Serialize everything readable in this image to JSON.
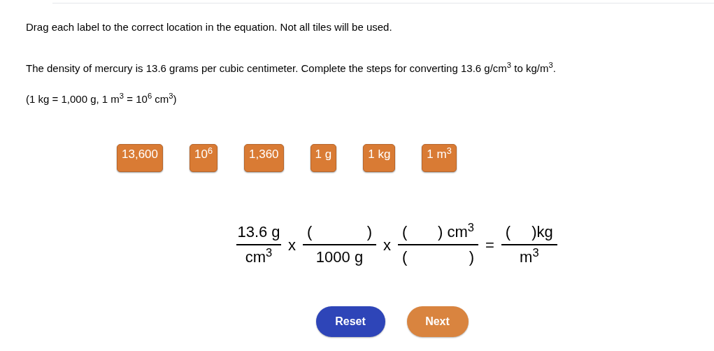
{
  "instructions": "Drag each label to the correct location in the equation. Not all tiles will be used.",
  "question": "The density of mercury is 13.6 grams per cubic centimeter. Complete the steps for converting 13.6 g/cm$^{3}$ to kg/m$^{3}$.",
  "hint": "(1 kg = 1,000 g, 1 m$^{3}$ = 10$^{6}$ cm$^{3}$)",
  "tiles": [
    "13,600",
    "10$^{6}$",
    "1,360",
    "1 g",
    "1 kg",
    "1 m$^{3}$"
  ],
  "equation": [
    {
      "kind": "fraction",
      "numerator": [
        "13.6 g"
      ],
      "denominator": [
        "cm$^{3}$"
      ]
    },
    {
      "kind": "operator",
      "text": "x"
    },
    {
      "kind": "fraction",
      "numerator": [
        "(",
        ")"
      ],
      "denominator": [
        "1000 g"
      ]
    },
    {
      "kind": "operator",
      "text": "x"
    },
    {
      "kind": "fraction",
      "numerator": [
        "(",
        ") cm$^{3}$"
      ],
      "denominator": [
        "(",
        ")"
      ]
    },
    {
      "kind": "operator",
      "text": "="
    },
    {
      "kind": "fraction",
      "numerator": [
        "(",
        ")kg"
      ],
      "denominator": [
        "m$^{3}$"
      ]
    }
  ],
  "buttons": [
    {
      "label": "Reset",
      "kind": "secondary"
    },
    {
      "label": "Next",
      "kind": "primary"
    }
  ]
}
